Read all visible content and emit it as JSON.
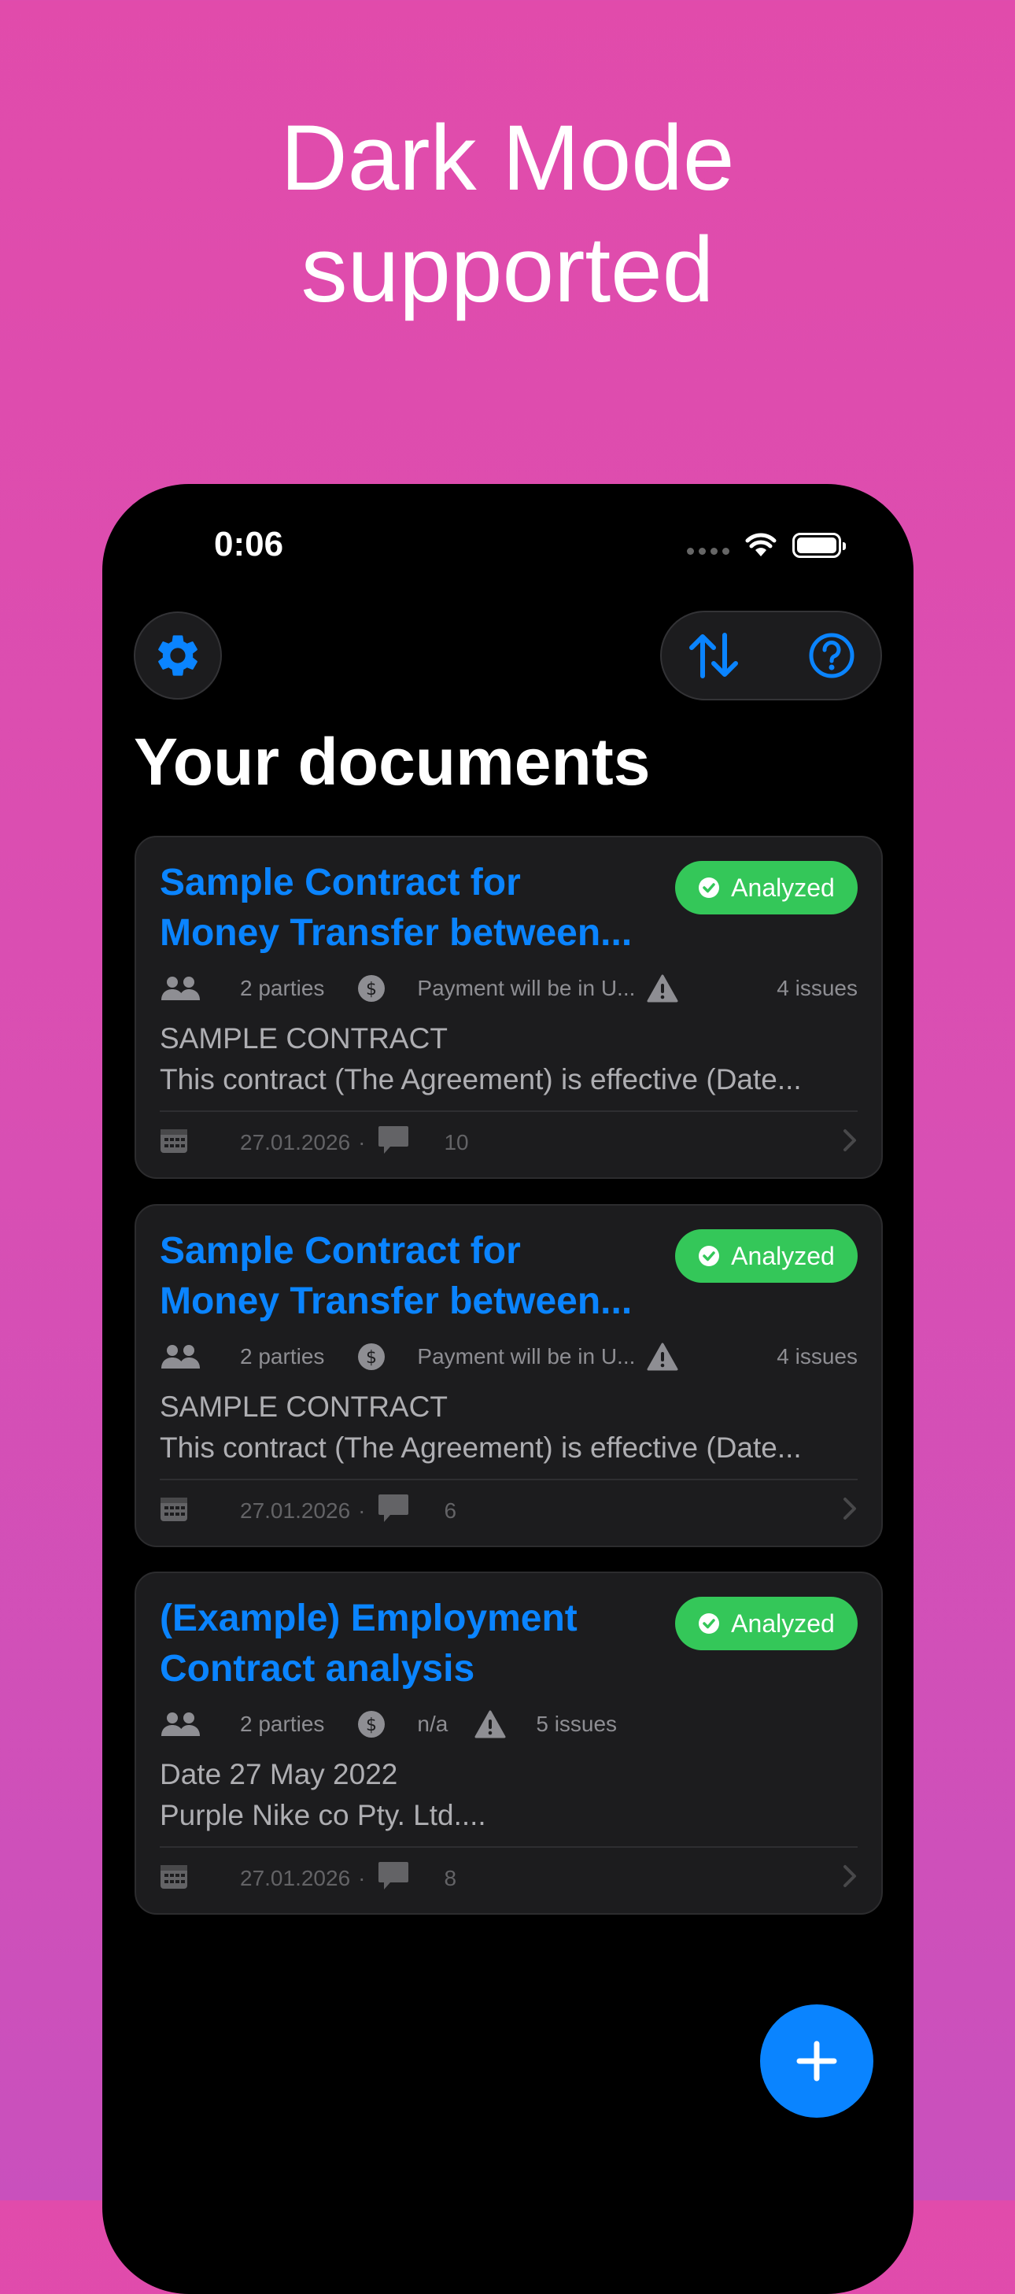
{
  "promo": {
    "line1": "Dark Mode",
    "line2": "supported"
  },
  "status_bar": {
    "time": "0:06"
  },
  "toolbar": {
    "settings_icon": "gear-icon",
    "sort_icon": "sort-arrows-icon",
    "help_icon": "question-circle-icon"
  },
  "page": {
    "title": "Your documents"
  },
  "documents": [
    {
      "title_line1": "Sample Contract for",
      "title_line2": "Money Transfer between...",
      "status": "Analyzed",
      "parties": "2 parties",
      "payment": "Payment will be in U...",
      "issues": "4 issues",
      "preview_line1": "SAMPLE CONTRACT",
      "preview_line2": "This contract (The Agreement) is effective (Date...",
      "date": "27.01.2026",
      "separator": "·",
      "comments": "10"
    },
    {
      "title_line1": "Sample Contract for",
      "title_line2": "Money Transfer between...",
      "status": "Analyzed",
      "parties": "2 parties",
      "payment": "Payment will be in U...",
      "issues": "4 issues",
      "preview_line1": "SAMPLE CONTRACT",
      "preview_line2": "This contract (The Agreement) is effective (Date...",
      "date": "27.01.2026",
      "separator": "·",
      "comments": "6"
    },
    {
      "title_line1": "(Example) Employment",
      "title_line2": "Contract analysis",
      "status": "Analyzed",
      "parties": "2 parties",
      "payment": "n/a",
      "issues": "5 issues",
      "preview_line1": "Date 27 May 2022",
      "preview_line2": "Purple Nike co Pty. Ltd....",
      "date": "27.01.2026",
      "separator": "·",
      "comments": "8"
    }
  ],
  "colors": {
    "accent": "#0a84ff",
    "analyzed_badge": "#34c759",
    "background_pink": "#dd4cae",
    "card": "#1c1c1e"
  }
}
